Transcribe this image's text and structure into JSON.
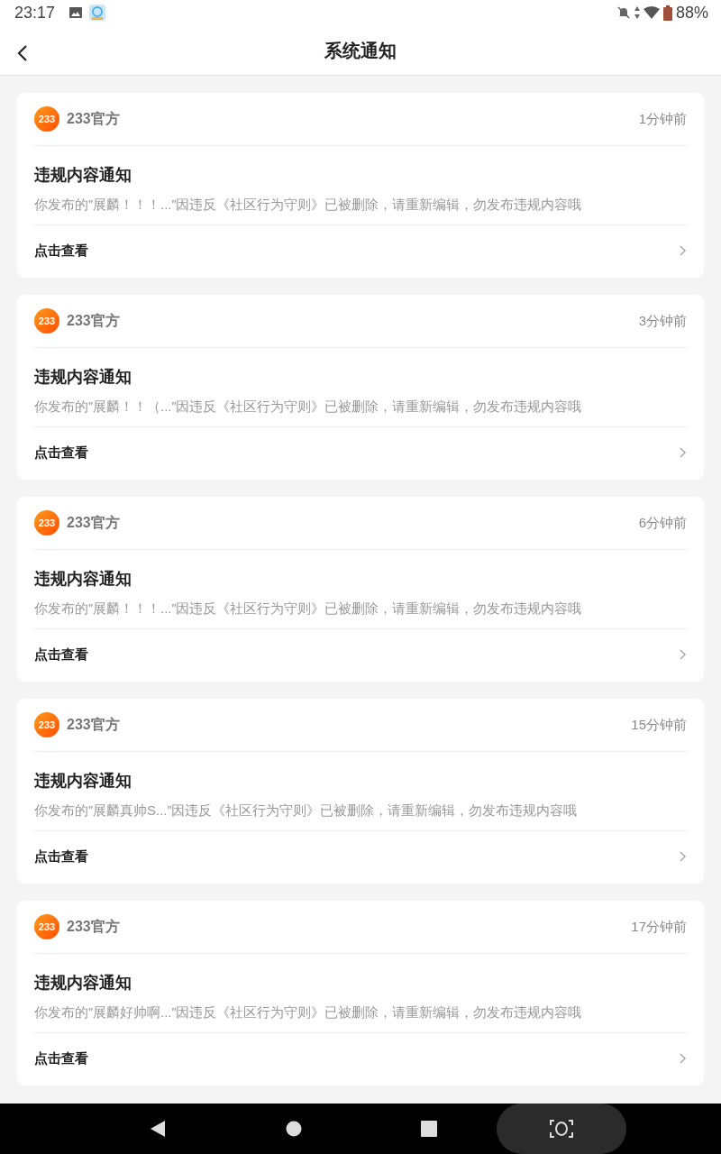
{
  "status_bar": {
    "time": "23:17",
    "battery": "88%"
  },
  "header": {
    "title": "系统通知"
  },
  "notifications": [
    {
      "logo_text": "233",
      "sender": "233官方",
      "time": "1分钟前",
      "title": "违规内容通知",
      "message": "你发布的”展麟！！！...”因违反《社区行为守则》已被删除，请重新编辑，勿发布违规内容哦",
      "action": "点击查看"
    },
    {
      "logo_text": "233",
      "sender": "233官方",
      "time": "3分钟前",
      "title": "违规内容通知",
      "message": "你发布的”展麟！！（...”因违反《社区行为守则》已被删除，请重新编辑，勿发布违规内容哦",
      "action": "点击查看"
    },
    {
      "logo_text": "233",
      "sender": "233官方",
      "time": "6分钟前",
      "title": "违规内容通知",
      "message": "你发布的”展麟！！！...”因违反《社区行为守则》已被删除，请重新编辑，勿发布违规内容哦",
      "action": "点击查看"
    },
    {
      "logo_text": "233",
      "sender": "233官方",
      "time": "15分钟前",
      "title": "违规内容通知",
      "message": "你发布的”展麟真帅S...”因违反《社区行为守则》已被删除，请重新编辑，勿发布违规内容哦",
      "action": "点击查看"
    },
    {
      "logo_text": "233",
      "sender": "233官方",
      "time": "17分钟前",
      "title": "违规内容通知",
      "message": "你发布的”展麟好帅啊...”因违反《社区行为守则》已被删除，请重新编辑，勿发布违规内容哦",
      "action": "点击查看"
    }
  ]
}
